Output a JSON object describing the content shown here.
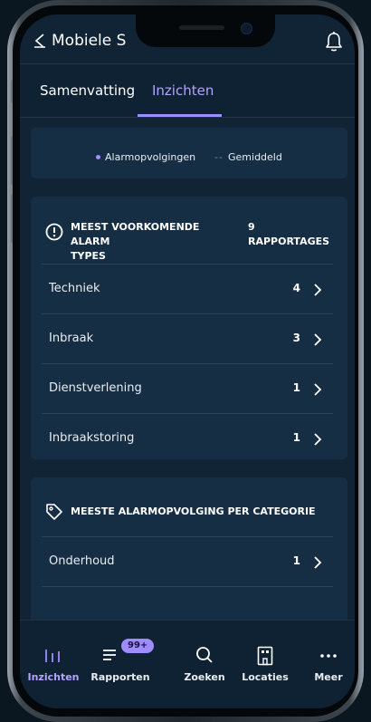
{
  "app": {
    "title": "Mobiele S"
  },
  "tabs": [
    {
      "label": "Samenvatting",
      "active": false
    },
    {
      "label": "Inzichten",
      "active": true
    }
  ],
  "legend": {
    "series_label": "Alarmopvolgingen",
    "average_label": "Gemiddeld"
  },
  "alarm_types": {
    "title_line1": "MEEST VOORKOMENDE ALARM",
    "title_line2": "TYPES",
    "count_line1": "9",
    "count_line2": "RAPPORTAGES",
    "rows": [
      {
        "label": "Techniek",
        "count": "4"
      },
      {
        "label": "Inbraak",
        "count": "3"
      },
      {
        "label": "Dienstverlening",
        "count": "1"
      },
      {
        "label": "Inbraakstoring",
        "count": "1"
      }
    ]
  },
  "categories": {
    "title": "MEESTE ALARMOPVOLGING PER CATEGORIE",
    "rows": [
      {
        "label": "Onderhoud",
        "count": "1"
      }
    ]
  },
  "nav": {
    "items": [
      {
        "label": "Inzichten",
        "icon": "bar-chart-icon",
        "active": true
      },
      {
        "label": "Rapporten",
        "icon": "list-icon",
        "badge": "99+"
      },
      {
        "label": "Zoeken",
        "icon": "search-icon"
      },
      {
        "label": "Locaties",
        "icon": "building-icon"
      },
      {
        "label": "Meer",
        "icon": "more-icon"
      }
    ]
  },
  "colors": {
    "accent": "#9f8cff",
    "background": "#102436",
    "card": "#162e44"
  }
}
